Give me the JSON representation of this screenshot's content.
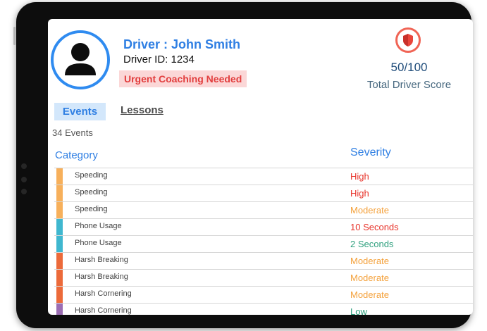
{
  "driver": {
    "name": "Driver : John Smith",
    "id_label": "Driver ID: 1234",
    "badge": "Urgent Coaching Needed"
  },
  "score": {
    "value": "50/100",
    "label": "Total Driver Score",
    "icon": "shield-icon",
    "accent": "#f06455"
  },
  "tabs": [
    {
      "label": "Events",
      "active": true
    },
    {
      "label": "Lessons",
      "active": false
    }
  ],
  "events_count": "34 Events",
  "table": {
    "category_header": "Category",
    "severity_header": "Severity",
    "rows": [
      {
        "category": "Speeding",
        "severity": "High",
        "bar_color": "#f7b05b",
        "severity_color": "#e8352c"
      },
      {
        "category": "Speeding",
        "severity": "High",
        "bar_color": "#f7b05b",
        "severity_color": "#e8352c"
      },
      {
        "category": "Speeding",
        "severity": "Moderate",
        "bar_color": "#f7b05b",
        "severity_color": "#f4a13b"
      },
      {
        "category": "Phone Usage",
        "severity": "10 Seconds",
        "bar_color": "#3fb7cf",
        "severity_color": "#e8352c"
      },
      {
        "category": "Phone Usage",
        "severity": "2 Seconds",
        "bar_color": "#3fb7cf",
        "severity_color": "#2fa07e"
      },
      {
        "category": "Harsh Breaking",
        "severity": "Moderate",
        "bar_color": "#ec6a3a",
        "severity_color": "#f4a13b"
      },
      {
        "category": "Harsh Breaking",
        "severity": "Moderate",
        "bar_color": "#ec6a3a",
        "severity_color": "#f4a13b"
      },
      {
        "category": "Harsh Cornering",
        "severity": "Moderate",
        "bar_color": "#ec6a3a",
        "severity_color": "#f4a13b"
      },
      {
        "category": "Harsh Cornering",
        "severity": "Low",
        "bar_color": "#9b6db3",
        "severity_color": "#2fa07e"
      }
    ]
  }
}
